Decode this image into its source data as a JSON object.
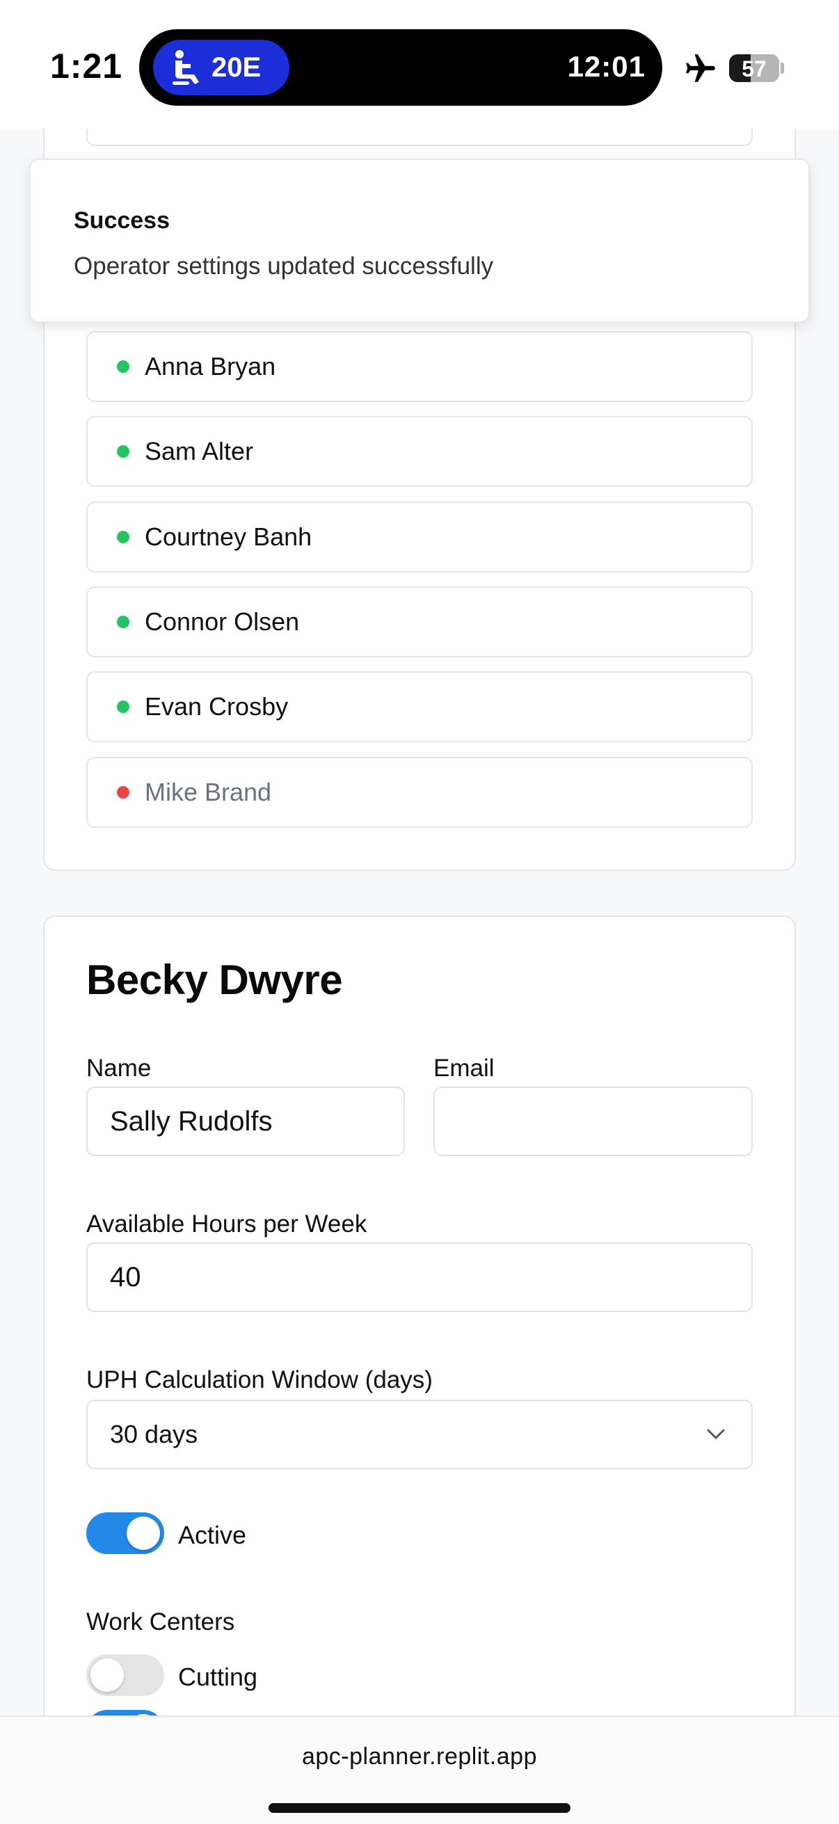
{
  "status_bar": {
    "time": "1:21",
    "flight_seat": "20E",
    "island_time": "12:01",
    "battery_level": "57",
    "battery_fraction": 0.57
  },
  "toast": {
    "title": "Success",
    "message": "Operator settings updated successfully"
  },
  "operators": [
    {
      "name": "Anna Bryan",
      "status": "active",
      "status_color": "#22c55e"
    },
    {
      "name": "Sam Alter",
      "status": "active",
      "status_color": "#22c55e"
    },
    {
      "name": "Courtney Banh",
      "status": "active",
      "status_color": "#22c55e"
    },
    {
      "name": "Connor Olsen",
      "status": "active",
      "status_color": "#22c55e"
    },
    {
      "name": "Evan Crosby",
      "status": "active",
      "status_color": "#22c55e"
    },
    {
      "name": "Mike Brand",
      "status": "inactive",
      "status_color": "#ef4444"
    }
  ],
  "editor": {
    "title": "Becky Dwyre",
    "name_label": "Name",
    "name_value": "Sally Rudolfs",
    "email_label": "Email",
    "email_value": "",
    "hours_label": "Available Hours per Week",
    "hours_value": "40",
    "uph_label": "UPH Calculation Window (days)",
    "uph_value": "30 days",
    "active_label": "Active",
    "active_on": true,
    "work_centers_label": "Work Centers",
    "work_centers": [
      {
        "label": "Cutting",
        "on": false
      }
    ]
  },
  "browser": {
    "url": "apc-planner.replit.app"
  },
  "colors": {
    "accent": "#2389e8",
    "flight_pill": "#1c2ed8",
    "active_dot": "#22c55e",
    "inactive_dot": "#ef4444"
  }
}
